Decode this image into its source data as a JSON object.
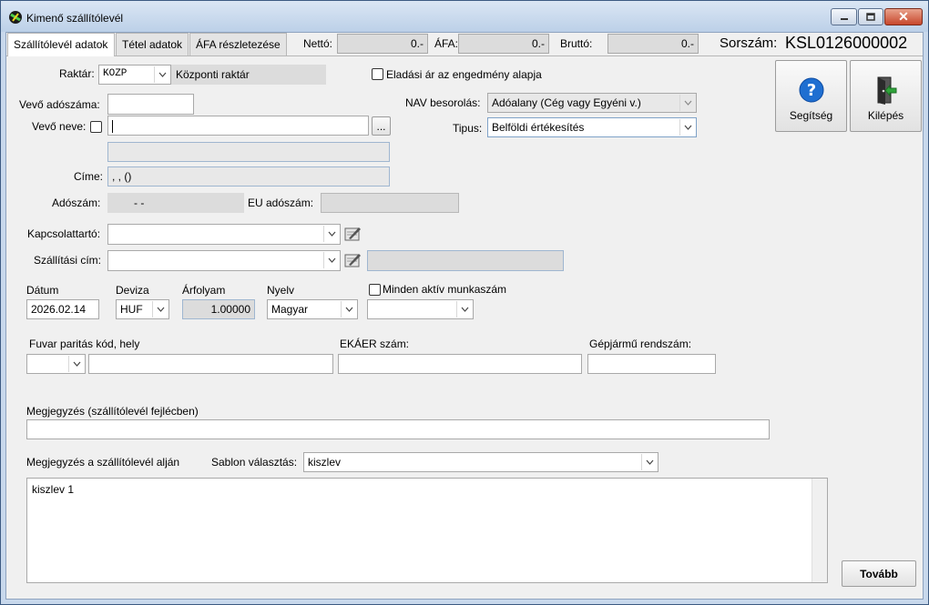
{
  "window": {
    "title": "Kimenő szállítólevél",
    "minimize_icon": "minimize-icon",
    "maximize_icon": "maximize-icon",
    "close_icon": "close-icon"
  },
  "tabs": [
    {
      "label": "Szállítólevél adatok",
      "active": true
    },
    {
      "label": "Tétel adatok",
      "active": false
    },
    {
      "label": "ÁFA részletezése",
      "active": false
    }
  ],
  "totals": {
    "netto_label": "Nettó:",
    "netto_value": "0.-",
    "afa_label": "ÁFA:",
    "afa_value": "0.-",
    "brutto_label": "Bruttó:",
    "brutto_value": "0.-",
    "sorszam_label": "Sorszám:",
    "sorszam_value": "KSL0126000002"
  },
  "form": {
    "raktar_label": "Raktár:",
    "raktar_code": "KOZP",
    "raktar_name": "Központi raktár",
    "eladasi_ar_label": "Eladási ár az engedmény alapja",
    "vevo_adoszama_label": "Vevő adószáma:",
    "vevo_adoszama_value": "",
    "vevo_neve_label": "Vevő neve:",
    "vevo_neve_value": "",
    "browse_label": "...",
    "vevo_extra_value": "",
    "cime_label": "Címe:",
    "cime_value": ", ,  ()",
    "adoszam_label": "Adószám:",
    "adoszam_value": "- -",
    "eu_adoszam_label": "EU adószám:",
    "eu_adoszam_value": "",
    "nav_label": "NAV besorolás:",
    "nav_value": "Adóalany (Cég vagy Egyéni v.)",
    "tipus_label": "Tipus:",
    "tipus_value": "Belföldi értékesítés",
    "kapcsolattarto_label": "Kapcsolattartó:",
    "kapcsolattarto_value": "",
    "szallitasi_cim_label": "Szállítási cím:",
    "szallitasi_cim_value": "",
    "szallitasi_cim_extra": "",
    "datum_label": "Dátum",
    "datum_value": "2026.02.14",
    "deviza_label": "Deviza",
    "deviza_value": "HUF",
    "arfolyam_label": "Árfolyam",
    "arfolyam_value": "1.00000",
    "nyelv_label": "Nyelv",
    "nyelv_value": "Magyar",
    "minden_aktiv_label": "Minden aktív munkaszám",
    "munkaszam_value": "",
    "fuvar_label": "Fuvar paritás kód, hely",
    "fuvar_kod_value": "",
    "fuvar_hely_value": "",
    "ekaer_label": "EKÁER szám:",
    "ekaer_value": "",
    "rendszam_label": "Gépjármű rendszám:",
    "rendszam_value": "",
    "megjegyzes_fejlec_label": "Megjegyzés (szállítólevél fejlécben)",
    "megjegyzes_fejlec_value": "",
    "megjegyzes_also_label": "Megjegyzés a szállítólevél alján",
    "sablon_label": "Sablon választás:",
    "sablon_value": "kiszlev",
    "megjegyzes_also_value": "kiszlev 1"
  },
  "buttons": {
    "segitseg_label": "Segítség",
    "segitseg_icon": "help-icon",
    "kilepes_label": "Kilépés",
    "kilepes_icon": "exit-door-icon",
    "tovabb_label": "Tovább"
  },
  "colors": {
    "help_blue": "#1f6fd1",
    "exit_green": "#2fa33a",
    "titlebar": "#c8d8ec",
    "close_red": "#c7472c"
  }
}
